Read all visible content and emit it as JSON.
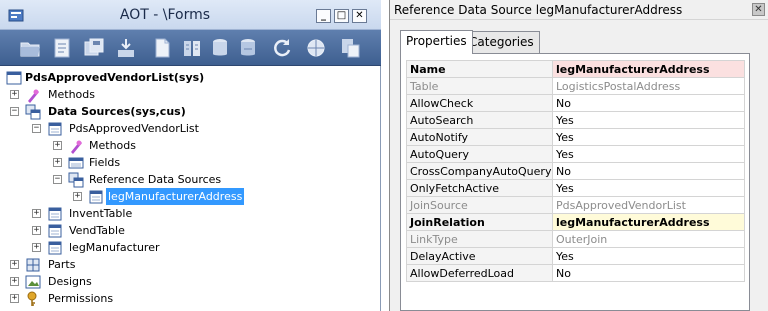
{
  "aot": {
    "title": "AOT - \\Forms",
    "window_buttons": {
      "minimize": "_",
      "maximize": "□",
      "close": "✕"
    },
    "toolbar": [
      "open-icon",
      "properties-icon",
      "save-all-icon",
      "import-icon",
      "new-icon",
      "compile-icon",
      "restore-icon",
      "sync-icon",
      "refresh-icon",
      "find-icon",
      "version-control-icon"
    ],
    "tree": {
      "root": "PdsApprovedVendorList(sys)",
      "methods": "Methods",
      "data_sources": "Data Sources(sys,cus)",
      "ds_pds": "PdsApprovedVendorList",
      "ds_pds_methods": "Methods",
      "ds_pds_fields": "Fields",
      "ds_pds_refds": "Reference Data Sources",
      "ds_pds_refds_item": "legManufacturerAddress",
      "ds_invent": "InventTable",
      "ds_vend": "VendTable",
      "ds_legman": "legManufacturer",
      "parts": "Parts",
      "designs": "Designs",
      "permissions": "Permissions"
    }
  },
  "props": {
    "title": "Reference Data Source legManufacturerAddress",
    "close": "✕",
    "tabs": {
      "properties": "Properties",
      "categories": "Categories"
    },
    "rows": [
      {
        "key": "Name",
        "value": "legManufacturerAddress"
      },
      {
        "key": "Table",
        "value": "LogisticsPostalAddress"
      },
      {
        "key": "AllowCheck",
        "value": "No"
      },
      {
        "key": "AutoSearch",
        "value": "Yes"
      },
      {
        "key": "AutoNotify",
        "value": "Yes"
      },
      {
        "key": "AutoQuery",
        "value": "Yes"
      },
      {
        "key": "CrossCompanyAutoQuery",
        "value": "No"
      },
      {
        "key": "OnlyFetchActive",
        "value": "Yes"
      },
      {
        "key": "JoinSource",
        "value": "PdsApprovedVendorList"
      },
      {
        "key": "JoinRelation",
        "value": "legManufacturerAddress"
      },
      {
        "key": "LinkType",
        "value": "OuterJoin"
      },
      {
        "key": "DelayActive",
        "value": "Yes"
      },
      {
        "key": "AllowDeferredLoad",
        "value": "No"
      }
    ]
  },
  "colors": {
    "selection": "#3399ff",
    "toolbar": "#4a6a9c",
    "name_highlight": "#fbe0e0",
    "join_highlight": "#fffbd9"
  }
}
